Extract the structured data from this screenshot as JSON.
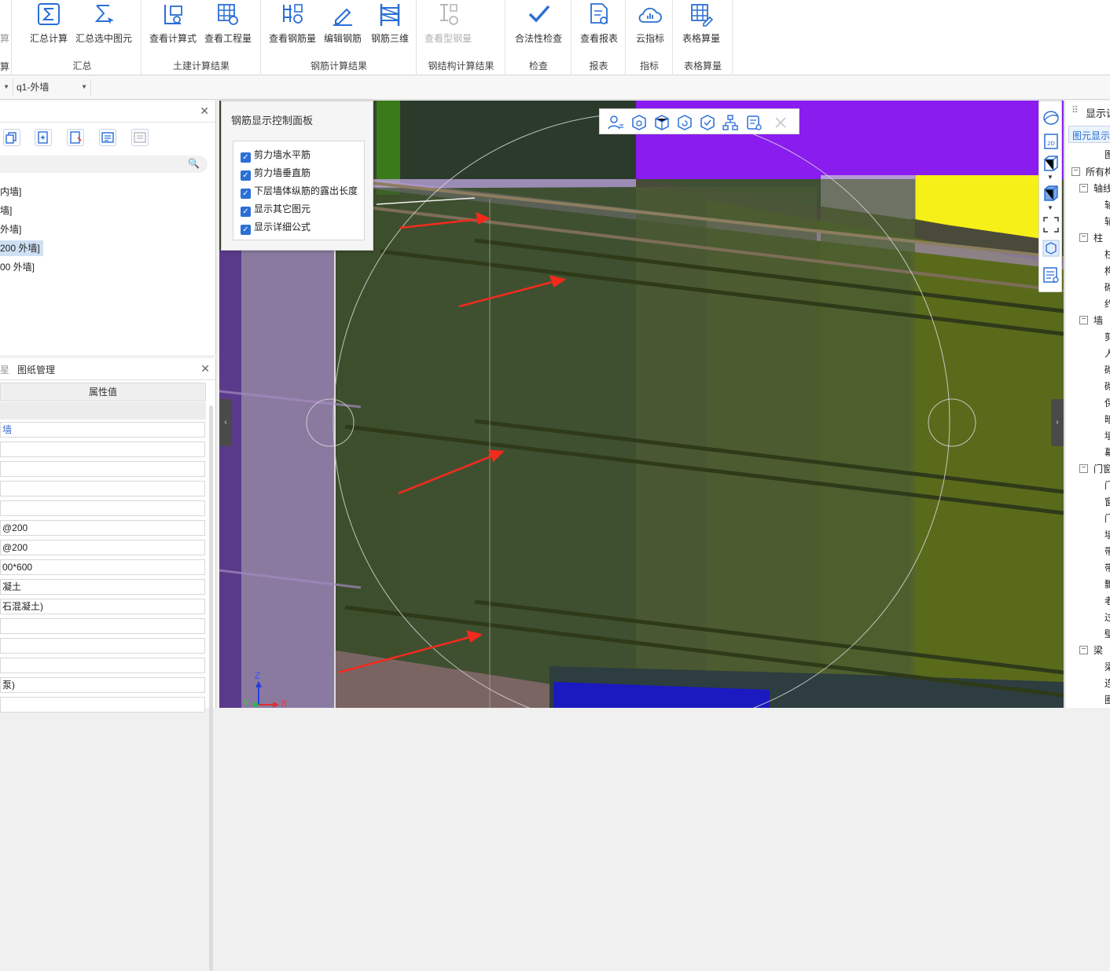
{
  "ribbon": {
    "cut_left_top": "算",
    "cut_left_bottom": "算",
    "groups": [
      {
        "title": "汇总",
        "buttons": [
          "汇总计算",
          "汇总选中图元"
        ]
      },
      {
        "title": "土建计算结果",
        "buttons": [
          "查看计算式",
          "查看工程量"
        ]
      },
      {
        "title": "钢筋计算结果",
        "buttons": [
          "查看钢筋量",
          "编辑钢筋",
          "钢筋三维"
        ]
      },
      {
        "title": "钢结构计算结果",
        "buttons": [
          "查看型钢量"
        ]
      },
      {
        "title": "检查",
        "buttons": [
          "合法性检查"
        ]
      },
      {
        "title": "报表",
        "buttons": [
          "查看报表"
        ]
      },
      {
        "title": "指标",
        "buttons": [
          "云指标"
        ]
      },
      {
        "title": "表格算量",
        "buttons": [
          "表格算量"
        ]
      }
    ]
  },
  "toolbar2": {
    "combo_value": "q1-外墙"
  },
  "left_top": {
    "tree_items": [
      "内墙]",
      "墙]",
      "外墙]",
      "200 外墙]",
      "00 外墙]"
    ],
    "selected_index": 3
  },
  "left_bottom": {
    "tab_cut": "星",
    "tab_drawing": "图纸管理",
    "prop_header": "属性值",
    "prop_values": [
      "墙",
      "",
      "",
      "",
      "",
      "@200",
      "@200",
      "00*600",
      "凝土",
      "石混凝土)",
      "",
      "",
      "",
      "泵)",
      ""
    ]
  },
  "control_panel": {
    "title": "钢筋显示控制面板",
    "options": [
      "剪力墙水平筋",
      "剪力墙垂直筋",
      "下层墙体纵筋的露出长度",
      "显示其它图元",
      "显示详细公式"
    ]
  },
  "axes": {
    "z": "Z",
    "x": "X",
    "y": "Y"
  },
  "right_panel": {
    "title_cut": "显示设",
    "subtitle_cut": "图元显示",
    "col_header_cut": "图",
    "nodes": [
      {
        "label": "所有构",
        "level": 0,
        "toggle": "−"
      },
      {
        "label": "轴线",
        "level": 1,
        "toggle": "−"
      },
      {
        "label": "轴",
        "level": 2
      },
      {
        "label": "辅",
        "level": 2
      },
      {
        "label": "柱",
        "level": 1,
        "toggle": "−"
      },
      {
        "label": "柱",
        "level": 2
      },
      {
        "label": "构",
        "level": 2
      },
      {
        "label": "砌",
        "level": 2
      },
      {
        "label": "约",
        "level": 2
      },
      {
        "label": "墙",
        "level": 1,
        "toggle": "−"
      },
      {
        "label": "剪",
        "level": 2
      },
      {
        "label": "人",
        "level": 2
      },
      {
        "label": "砌",
        "level": 2
      },
      {
        "label": "砌",
        "level": 2
      },
      {
        "label": "保",
        "level": 2
      },
      {
        "label": "暗",
        "level": 2
      },
      {
        "label": "墙",
        "level": 2
      },
      {
        "label": "幕",
        "level": 2
      },
      {
        "label": "门窗",
        "level": 1,
        "toggle": "−"
      },
      {
        "label": "门",
        "level": 2
      },
      {
        "label": "窗",
        "level": 2
      },
      {
        "label": "门",
        "level": 2
      },
      {
        "label": "墙",
        "level": 2
      },
      {
        "label": "带",
        "level": 2
      },
      {
        "label": "带",
        "level": 2
      },
      {
        "label": "飘",
        "level": 2
      },
      {
        "label": "老",
        "level": 2
      },
      {
        "label": "过",
        "level": 2
      },
      {
        "label": "壁",
        "level": 2
      },
      {
        "label": "梁",
        "level": 1,
        "toggle": "−"
      },
      {
        "label": "梁",
        "level": 2
      },
      {
        "label": "连",
        "level": 2
      },
      {
        "label": "圈",
        "level": 2
      }
    ]
  },
  "colors": {
    "accent": "#2b6fd6",
    "purple": "#8a1cf0",
    "yellow": "#f7ef18",
    "wall_green": "#55661e",
    "arrow_red": "#f42a1d"
  }
}
